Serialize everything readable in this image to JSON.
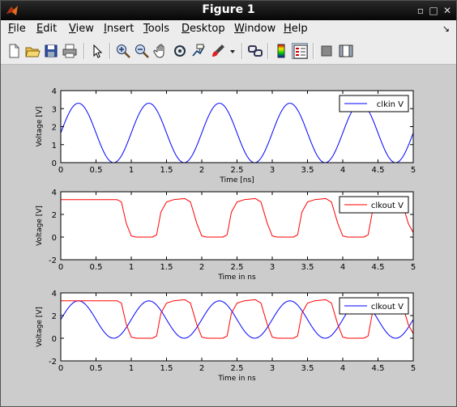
{
  "window": {
    "title": "Figure 1"
  },
  "menu": [
    "File",
    "Edit",
    "View",
    "Insert",
    "Tools",
    "Desktop",
    "Window",
    "Help"
  ],
  "menu_accel": [
    "F",
    "E",
    "V",
    "I",
    "T",
    "D",
    "W",
    "H"
  ],
  "toolbar_icons": [
    "new-figure-icon",
    "open-file-icon",
    "save-icon",
    "print-icon",
    "edit-plot-icon",
    "zoom-in-icon",
    "zoom-out-icon",
    "pan-icon",
    "rotate-3d-icon",
    "data-cursor-icon",
    "brush-icon",
    "link-plot-icon",
    "colorbar-icon",
    "legend-icon",
    "hide-plot-tools-icon",
    "show-plot-tools-icon"
  ],
  "colors": {
    "blue": "#0000ff",
    "red": "#ff0000"
  },
  "chart_data": [
    {
      "type": "line",
      "xlabel": "Time [ns]",
      "ylabel": "Voltage [V]",
      "xlim": [
        0,
        5
      ],
      "ylim": [
        0,
        4
      ],
      "xticks": [
        "0",
        "0.5",
        "1",
        "1.5",
        "2",
        "2.5",
        "3",
        "3.5",
        "4",
        "4.5",
        "5"
      ],
      "yticks": [
        "0",
        "1",
        "2",
        "3",
        "4"
      ],
      "legend_position": "top-right",
      "series": [
        {
          "name": "clkin V",
          "color": "#0000ff",
          "kind": "sine",
          "offset": 1.65,
          "amplitude": 1.65,
          "period": 1.0,
          "phase_peak": 0.25
        }
      ]
    },
    {
      "type": "line",
      "xlabel": "Time in ns",
      "ylabel": "Voltage [V]",
      "xlim": [
        0,
        5
      ],
      "ylim": [
        -2,
        4
      ],
      "xticks": [
        "0",
        "0.5",
        "1",
        "1.5",
        "2",
        "2.5",
        "3",
        "3.5",
        "4",
        "4.5",
        "5"
      ],
      "yticks": [
        "-2",
        "0",
        "2",
        "4"
      ],
      "legend_position": "top-right",
      "series": [
        {
          "name": "clkout V",
          "color": "#ff0000",
          "kind": "clock",
          "points": [
            [
              0,
              3.3
            ],
            [
              0.8,
              3.3
            ],
            [
              0.86,
              3.1
            ],
            [
              0.93,
              1.2
            ],
            [
              1.0,
              0.1
            ],
            [
              1.07,
              0.0
            ],
            [
              1.3,
              0.0
            ],
            [
              1.36,
              0.2
            ],
            [
              1.42,
              2.2
            ],
            [
              1.5,
              3.1
            ],
            [
              1.6,
              3.3
            ],
            [
              1.76,
              3.4
            ],
            [
              1.84,
              3.1
            ],
            [
              1.93,
              1.2
            ],
            [
              2.0,
              0.1
            ],
            [
              2.07,
              0.0
            ],
            [
              2.3,
              0.0
            ],
            [
              2.36,
              0.2
            ],
            [
              2.42,
              2.2
            ],
            [
              2.5,
              3.1
            ],
            [
              2.6,
              3.3
            ],
            [
              2.76,
              3.4
            ],
            [
              2.84,
              3.1
            ],
            [
              2.93,
              1.2
            ],
            [
              3.0,
              0.1
            ],
            [
              3.07,
              0.0
            ],
            [
              3.3,
              0.0
            ],
            [
              3.36,
              0.2
            ],
            [
              3.42,
              2.2
            ],
            [
              3.5,
              3.1
            ],
            [
              3.6,
              3.3
            ],
            [
              3.76,
              3.4
            ],
            [
              3.84,
              3.1
            ],
            [
              3.93,
              1.2
            ],
            [
              4.0,
              0.1
            ],
            [
              4.07,
              0.0
            ],
            [
              4.3,
              0.0
            ],
            [
              4.36,
              0.2
            ],
            [
              4.42,
              2.2
            ],
            [
              4.5,
              3.1
            ],
            [
              4.6,
              3.3
            ],
            [
              4.76,
              3.4
            ],
            [
              4.84,
              3.1
            ],
            [
              4.93,
              1.2
            ],
            [
              5.0,
              0.4
            ]
          ]
        }
      ]
    },
    {
      "type": "line",
      "xlabel": "Time in ns",
      "ylabel": "Voltage [V]",
      "xlim": [
        0,
        5
      ],
      "ylim": [
        -2,
        4
      ],
      "xticks": [
        "0",
        "0.5",
        "1",
        "1.5",
        "2",
        "2.5",
        "3",
        "3.5",
        "4",
        "4.5",
        "5"
      ],
      "yticks": [
        "-2",
        "0",
        "2",
        "4"
      ],
      "legend_position": "top-right",
      "series": [
        {
          "name": "clkout V",
          "color": "#0000ff",
          "kind": "sine",
          "offset": 1.65,
          "amplitude": 1.65,
          "period": 1.0,
          "phase_peak": 0.25
        },
        {
          "name": "",
          "color": "#ff0000",
          "kind": "clock-ref",
          "ref_series": 1
        }
      ]
    }
  ]
}
